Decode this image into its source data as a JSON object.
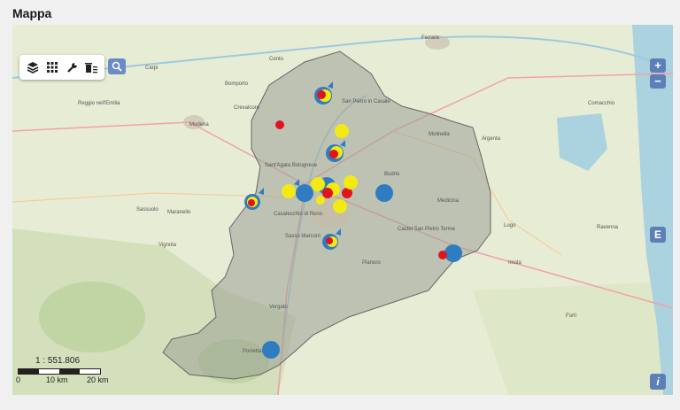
{
  "panel": {
    "title": "Mappa"
  },
  "toolbar": {
    "tools": [
      {
        "name": "layers-icon"
      },
      {
        "name": "grid-icon"
      },
      {
        "name": "wrench-icon"
      },
      {
        "name": "trash-list-icon"
      }
    ],
    "search_icon": "search-icon"
  },
  "zoom": {
    "in_label": "+",
    "out_label": "−"
  },
  "side_buttons": {
    "edit_label": "E",
    "info_label": "i"
  },
  "scale": {
    "ratio": "1 : 551.806",
    "labels": [
      "0",
      "10 km",
      "20 km"
    ]
  },
  "place_names": [
    "Ferrara",
    "Reggio nell'Emilia",
    "Modena",
    "Ravenna",
    "Comacchio",
    "San Pietro in Casale",
    "Casalecchio di Reno",
    "Sasso Marconi",
    "Budrio",
    "Medicina",
    "Argenta",
    "Molinella",
    "Imola",
    "Lugo",
    "Castel San Pietro Terme",
    "Vignola",
    "Maranello",
    "Sassuolo",
    "Carpi",
    "Bomporto",
    "Forlì",
    "Cento",
    "Crevalcore",
    "Sant'Agata Bolognese",
    "Pianoro",
    "Vergato",
    "Porretta Terme"
  ],
  "colors": {
    "blue_marker": "#2f7cc1",
    "yellow_marker": "#f3ea13",
    "red_marker": "#e0141e",
    "province_fill": "#9aa095",
    "sea": "#aad3df",
    "button_blue": "#5d7fb8"
  }
}
